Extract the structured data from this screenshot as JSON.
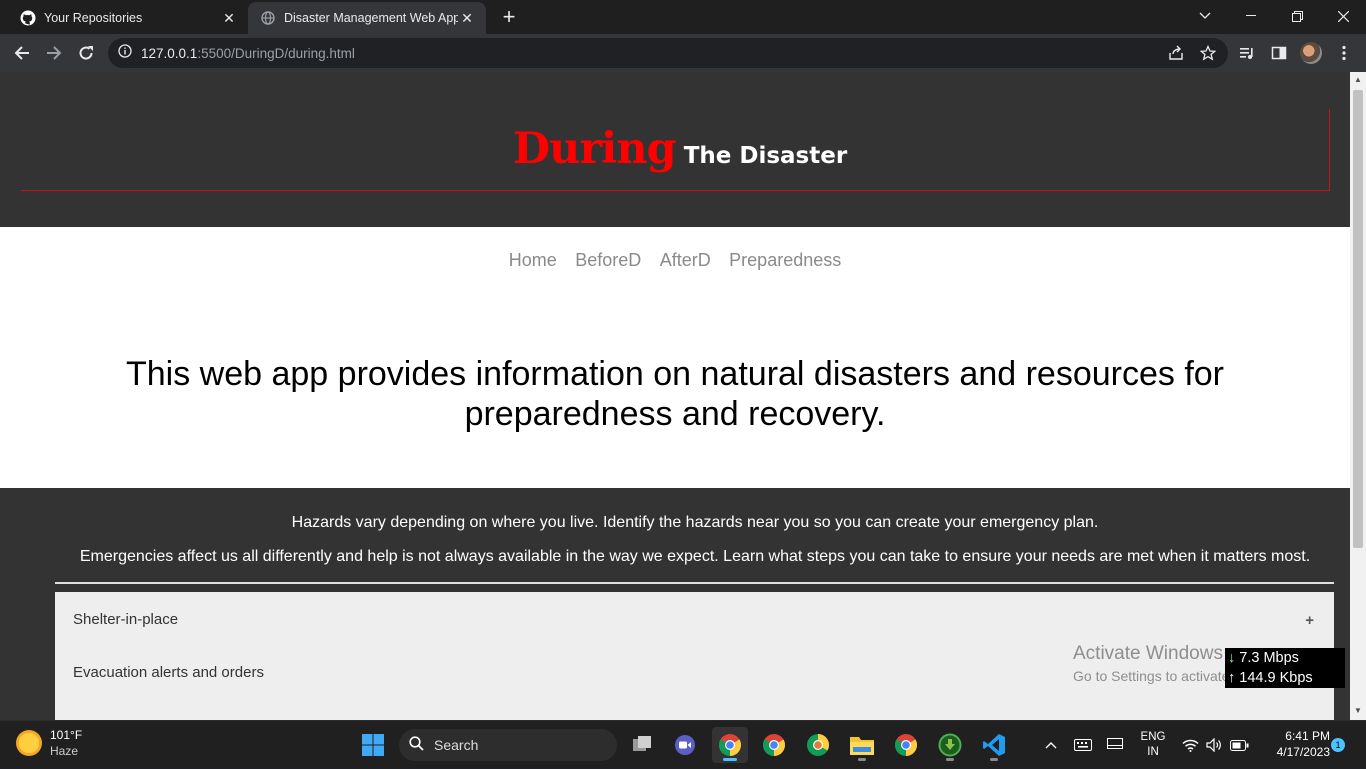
{
  "browser": {
    "tabs": [
      {
        "title": "Your Repositories",
        "active": false
      },
      {
        "title": "Disaster Management Web App",
        "active": true
      }
    ],
    "url_host": "127.0.0.1",
    "url_rest": ":5500/DuringD/during.html"
  },
  "page": {
    "hero_title_accent": "During",
    "hero_title_rest": "The Disaster",
    "nav": [
      "Home",
      "BeforeD",
      "AfterD",
      "Preparedness"
    ],
    "intro": "This web app provides information on natural disasters and resources for preparedness and recovery.",
    "info_line_1": "Hazards vary depending on where you live. Identify the hazards near you so you can create your emergency plan.",
    "info_line_2": "Emergencies affect us all differently and help is not always available in the way we expect. Learn what steps you can take to ensure your needs are met when it matters most.",
    "accordion": [
      "Shelter-in-place",
      "Evacuation alerts and orders"
    ],
    "accordion_toggle": "+"
  },
  "overlay": {
    "watermark_title": "Activate Windows",
    "watermark_sub": "Go to Settings to activate Windows.",
    "net_down": "7.3 Mbps",
    "net_up": "144.9 Kbps"
  },
  "taskbar": {
    "weather_temp": "101°F",
    "weather_cond": "Haze",
    "search_placeholder": "Search",
    "lang_1": "ENG",
    "lang_2": "IN",
    "time": "6:41 PM",
    "date": "4/17/2023",
    "notif_count": "1"
  },
  "colors": {
    "accent_red": "#ff0000",
    "header_bg": "#333333",
    "nav_text": "#8a8a8a"
  }
}
